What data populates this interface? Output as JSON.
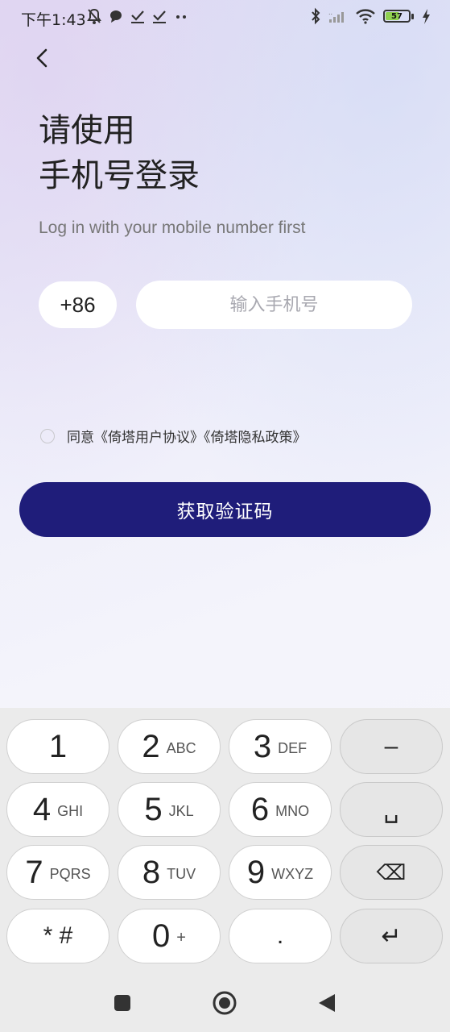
{
  "status_bar": {
    "time": "下午1:43",
    "battery_level": "57",
    "icons": [
      "mute-bell-icon",
      "chat-bubble-icon",
      "check-icon",
      "check-icon",
      "more-dots-icon",
      "bluetooth-icon",
      "signal-icon",
      "wifi-icon",
      "battery-icon",
      "charging-icon"
    ]
  },
  "header": {
    "back_icon": "chevron-left-icon",
    "title_line1": "请使用",
    "title_line2": "手机号登录",
    "subtitle": "Log in with your mobile number first"
  },
  "form": {
    "country_code": "+86",
    "phone_placeholder": "输入手机号",
    "phone_value": "",
    "agreement_text": "同意《倚塔用户协议》《倚塔隐私政策》",
    "agreement_checked": false,
    "submit_label": "获取验证码",
    "submit_color": "#1f1d7a"
  },
  "keyboard": {
    "keys": [
      {
        "digit": "1",
        "letters": ""
      },
      {
        "digit": "2",
        "letters": "ABC"
      },
      {
        "digit": "3",
        "letters": "DEF"
      },
      {
        "digit": "–",
        "letters": ""
      },
      {
        "digit": "4",
        "letters": "GHI"
      },
      {
        "digit": "5",
        "letters": "JKL"
      },
      {
        "digit": "6",
        "letters": "MNO"
      },
      {
        "digit": "␣",
        "letters": ""
      },
      {
        "digit": "7",
        "letters": "PQRS"
      },
      {
        "digit": "8",
        "letters": "TUV"
      },
      {
        "digit": "9",
        "letters": "WXYZ"
      },
      {
        "digit": "⌫",
        "letters": ""
      },
      {
        "digit": "* #",
        "letters": ""
      },
      {
        "digit": "0",
        "letters": "+"
      },
      {
        "digit": ".",
        "letters": ""
      },
      {
        "digit": "↵",
        "letters": ""
      }
    ]
  },
  "nav": {
    "icons": [
      "recent-apps-icon",
      "home-icon",
      "back-triangle-icon"
    ]
  }
}
